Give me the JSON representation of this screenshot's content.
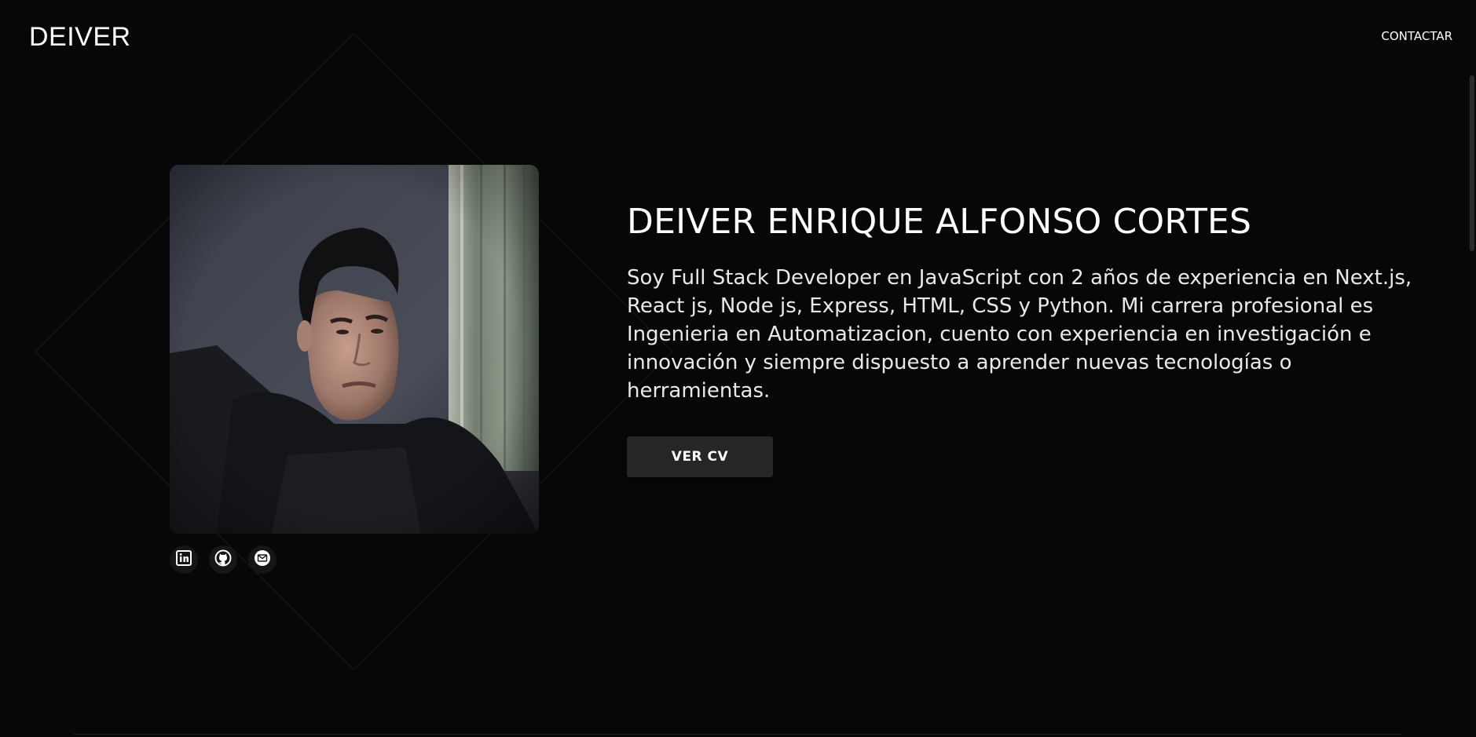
{
  "header": {
    "logo": "DEIVER",
    "nav_contact": "CONTACTAR"
  },
  "hero": {
    "name": "DEIVER ENRIQUE ALFONSO CORTES",
    "bio": "Soy Full Stack Developer en JavaScript con 2 años de experiencia en Next.js, React js, Node js, Express, HTML, CSS y Python. Mi carrera profesional es Ingenieria en Automatizacion, cuento con experiencia en investigación e innovación y siempre dispuesto a aprender nuevas tecnologías o herramientas.",
    "cv_button": "VER CV"
  },
  "socials": [
    {
      "icon": "linkedin-icon"
    },
    {
      "icon": "github-icon"
    },
    {
      "icon": "mail-icon"
    }
  ],
  "colors": {
    "background": "#070707",
    "button": "#262626",
    "text": "#ffffff"
  }
}
